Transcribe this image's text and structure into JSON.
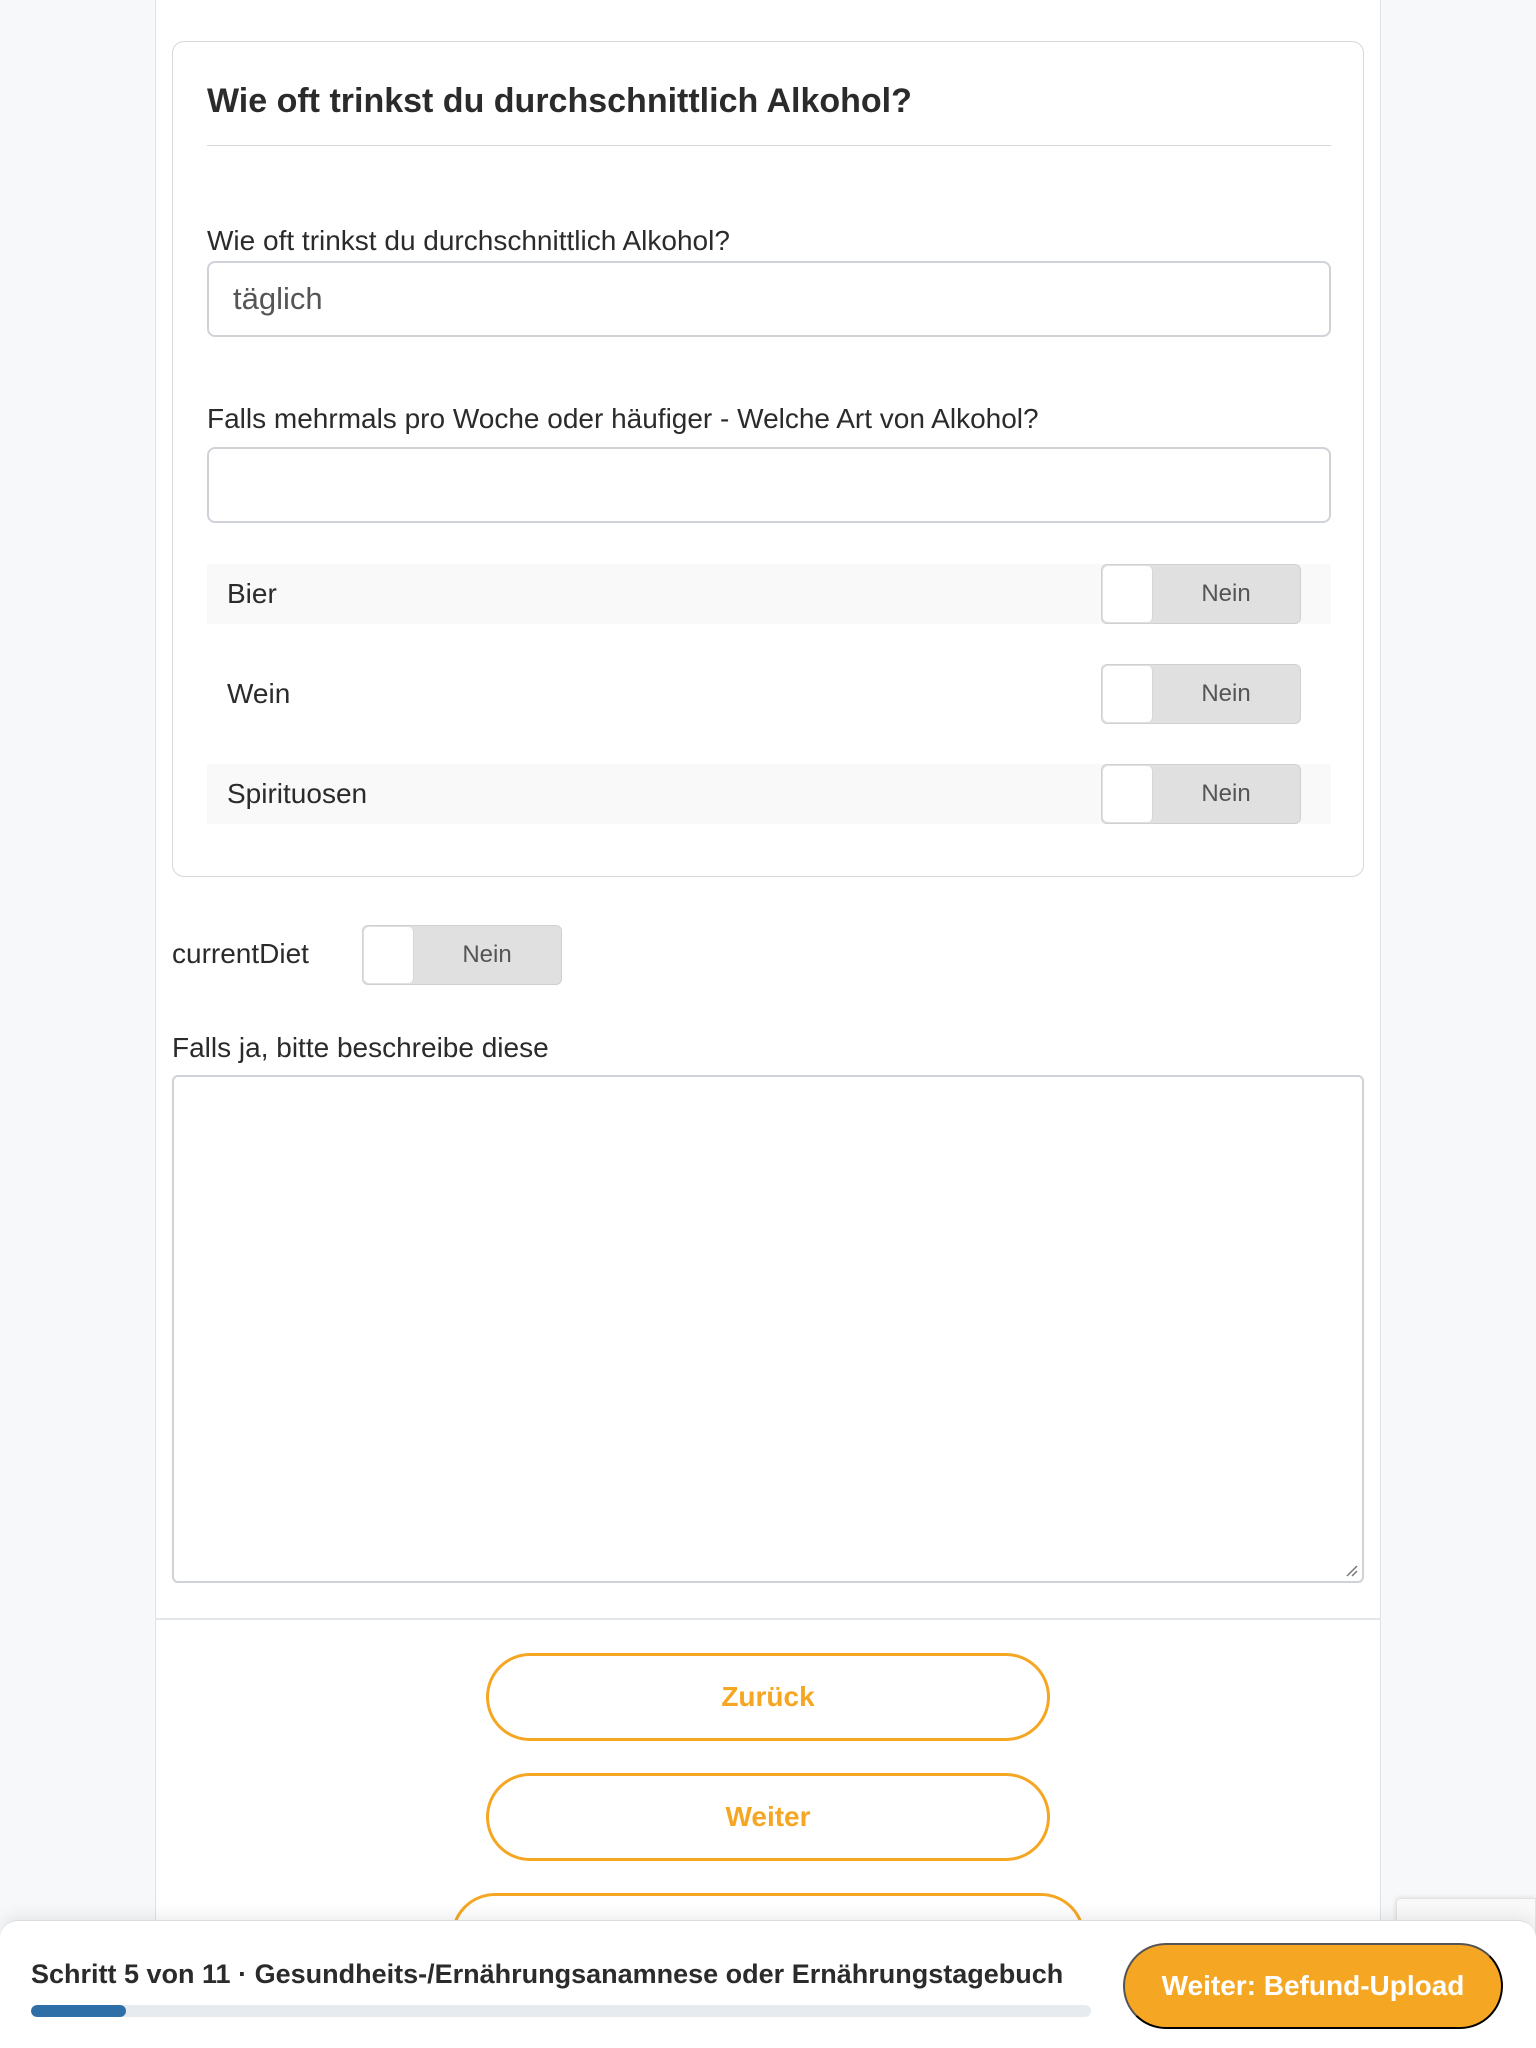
{
  "alcohol_group": {
    "title": "Wie oft trinkst du durchschnittlich Alkohol?",
    "frequency_label": "Wie oft trinkst du durchschnittlich Alkohol?",
    "frequency_value": "täglich",
    "type_label": "Falls mehrmals pro Woche oder häufiger - Welche Art von Alkohol?",
    "type_value": "",
    "types": [
      {
        "label": "Bier",
        "toggle": "Nein"
      },
      {
        "label": "Wein",
        "toggle": "Nein"
      },
      {
        "label": "Spirituosen",
        "toggle": "Nein"
      }
    ]
  },
  "diet": {
    "label": "currentDiet",
    "toggle": "Nein",
    "describe_label": "Falls ja, bitte beschreibe diese",
    "describe_value": ""
  },
  "nav": {
    "back_label": "Zurück",
    "next_label": "Weiter"
  },
  "bottom_bar": {
    "step_text": "Schritt 5 von 11 · Gesundheits-/Ernährungsanamnese oder Ernährungstagebuch",
    "progress": 0.09,
    "next_step_label": "Weiter: Befund-Upload"
  },
  "colors": {
    "accent": "#f5a623",
    "progress": "#2f6fa8"
  }
}
